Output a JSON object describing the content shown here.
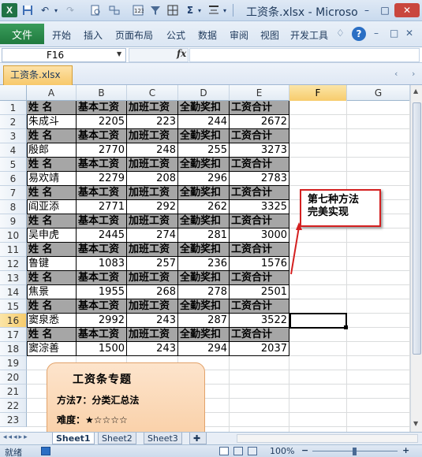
{
  "titlebar": {
    "title": "工资条.xlsx - Microso",
    "minimize": "–",
    "maximize": "□",
    "close": "✕"
  },
  "ribbon": {
    "file_label": "文件",
    "tabs": [
      "开始",
      "插入",
      "页面布局",
      "公式",
      "数据",
      "审阅",
      "视图",
      "开发工具"
    ]
  },
  "formula_bar": {
    "name_box": "F16",
    "fx_label": "fx",
    "formula": ""
  },
  "workbook_tab": "工资条.xlsx",
  "columns": [
    "A",
    "B",
    "C",
    "D",
    "E",
    "F",
    "G"
  ],
  "active_column": "F",
  "rows": [
    "1",
    "2",
    "3",
    "4",
    "5",
    "6",
    "7",
    "8",
    "9",
    "10",
    "11",
    "12",
    "13",
    "14",
    "15",
    "16",
    "17",
    "18",
    "19",
    "20",
    "21",
    "22",
    "23"
  ],
  "active_row": "16",
  "header_labels": [
    "姓  名",
    "基本工资",
    "加班工资",
    "全勤奖扣",
    "工资合计"
  ],
  "records": [
    [
      "朱成斗",
      "2205",
      "223",
      "244",
      "2672"
    ],
    [
      "殷郎",
      "2770",
      "248",
      "255",
      "3273"
    ],
    [
      "易欢靖",
      "2279",
      "208",
      "296",
      "2783"
    ],
    [
      "阎亚添",
      "2771",
      "292",
      "262",
      "3325"
    ],
    [
      "吴申虎",
      "2445",
      "274",
      "281",
      "3000"
    ],
    [
      "鲁键",
      "1083",
      "257",
      "236",
      "1576"
    ],
    [
      "焦景",
      "1955",
      "268",
      "278",
      "2501"
    ],
    [
      "窦泉悉",
      "2992",
      "243",
      "287",
      "3522"
    ],
    [
      "窦淙善",
      "1500",
      "243",
      "294",
      "2037"
    ]
  ],
  "callout": {
    "line1": "第七种方法",
    "line2": "完美实现"
  },
  "card": {
    "title": "工资条专题",
    "method": "方法7：分类汇总法",
    "difficulty_label": "难度：",
    "difficulty_stars": "★☆☆☆☆"
  },
  "sheets": [
    "Sheet1",
    "Sheet2",
    "Sheet3"
  ],
  "active_sheet": "Sheet1",
  "status": {
    "ready": "就绪",
    "zoom": "100%",
    "zoom_minus": "−",
    "zoom_plus": "+"
  },
  "colors": {
    "header_fill": "#a6a6a6",
    "callout_border": "#d42020",
    "card_fill": "#fbd9b8",
    "file_tab": "#1f7a3e"
  }
}
